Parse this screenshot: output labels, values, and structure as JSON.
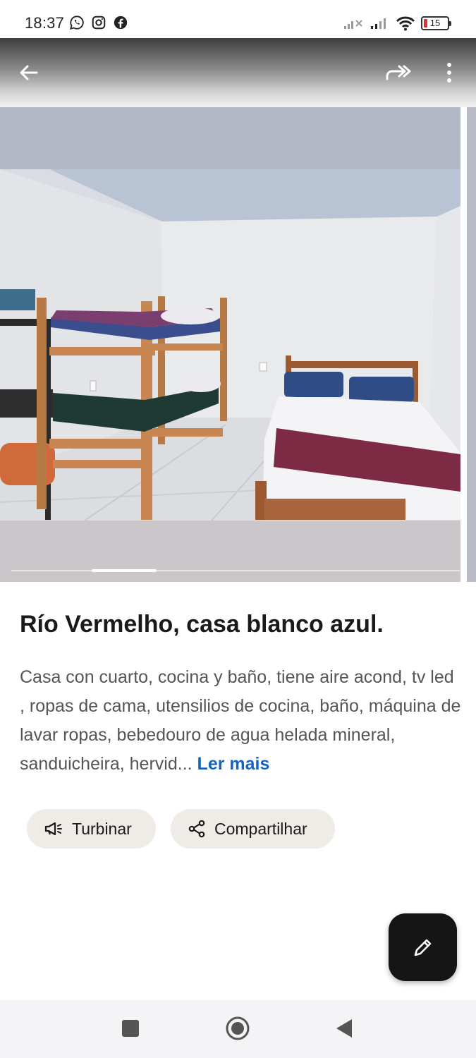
{
  "status_bar": {
    "time": "18:37",
    "left_icons": [
      "whatsapp-icon",
      "instagram-icon",
      "facebook-icon"
    ],
    "right_icons": [
      "no-signal-icon",
      "signal-icon",
      "wifi-icon"
    ],
    "battery": "15"
  },
  "app_bar": {
    "back_icon": "back-arrow-icon",
    "share_icon": "forward-share-icon",
    "more_icon": "more-vert-icon"
  },
  "photo": {
    "description_icon": "bedroom-photo"
  },
  "listing": {
    "title": "Río Vermelho, casa blanco azul.",
    "description": "Casa con cuarto, cocina y baño, tiene aire acond, tv led , ropas de cama, utensilios de cocina, baño, máquina de lavar ropas, bebedouro de agua helada mineral, sanduicheira, hervid...",
    "read_more": "Ler mais"
  },
  "actions": {
    "turbinar_label": "Turbinar",
    "share_label": "Compartilhar"
  },
  "colors": {
    "accent_link": "#1565c0",
    "chip_bg": "#efece8",
    "fab_bg": "#151515"
  }
}
